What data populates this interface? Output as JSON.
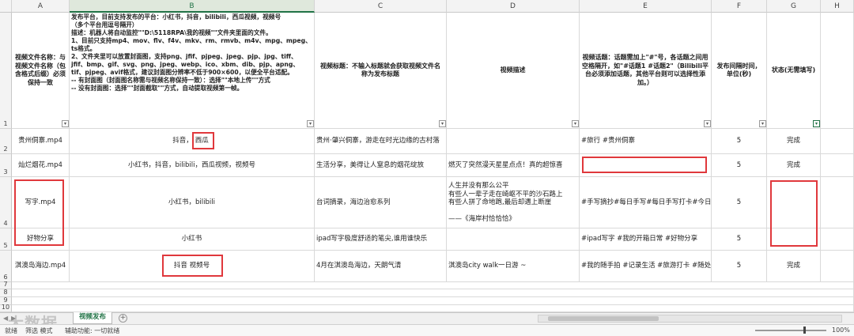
{
  "columns": [
    "A",
    "B",
    "C",
    "D",
    "E",
    "F",
    "G",
    "H"
  ],
  "rows": [
    "1",
    "2",
    "3",
    "4",
    "5",
    "6",
    "7",
    "8",
    "9",
    "10"
  ],
  "header": {
    "a": "视频文件名称：与视频文件名称（包含格式后缀）必须保持一致",
    "b_lines": [
      "发布平台，目前支持发布的平台：小红书，抖音，bilibili，西瓜视频，视频号",
      "（多个平台用逗号隔开）",
      "描述：机器人将自动监控\"\"D:\\5118RPA\\我的视频\"\"文件夹里面的文件。",
      "1、目前只支持mp4、mov、flv、f4v、mkv、rm、rmvb、m4v、mpg、mpeg、ts格式。",
      "2、文件夹里可以放置封面图，支持png、jfif、pjpeg、jpeg、pjp、jpg、tiff、jfif、bmp、gif、svg、png、jpeg、webp、ico、xbm、dib、pjp、apng、tif、pjpeg、avif格式，建议封面图分辨率不低于900×600，以便全平台适配。",
      "-- 有封面图（封面图名称需与视频名称保持一致）：选择\"\"本地上传\"\"方式",
      "-- 没有封面图：选择\"\"封面截取\"\"方式，自动提取视频第一帧。"
    ],
    "c": "视频标题：不输入标题就会获取视频文件名称为发布标题",
    "d": "视频描述",
    "e": "视频话题：话题需加上\"#\"号，各话题之间用空格隔开，如\"#话题1 #话题2\"（Bilibili平台必须添加话题，其他平台则可以选择性添加。）",
    "f": "发布间隔时间，单位(秒)",
    "g": "状态(无需填写)"
  },
  "data_rows": [
    {
      "a": "贵州侗寨.mp4",
      "b1": "抖音，",
      "b2": "西瓜",
      "c": "贵州·肇兴侗寨，游走在时光边缘的古村落",
      "d": "",
      "e": "#旅行 #贵州侗寨",
      "f": "5",
      "g": "完成"
    },
    {
      "a": "灿烂烟花.mp4",
      "b": "小红书，抖音，bilibili，西瓜视频，视频号",
      "c": "生活分享，美得让人窒息的烟花绽放",
      "d": "燃灭了突然漫天星星点点！真的超惊喜",
      "e": "",
      "f": "5",
      "g": "完成"
    },
    {
      "a": "写字.mp4",
      "b": "小红书，bilibili",
      "c": "台词摘录，海边治愈系列",
      "d_lines": [
        "人生并没有那么公平",
        "有些人一辈子走在崎岖不平的沙石路上",
        "有些人拼了命地跑,最后却遇上断崖",
        "",
        "——《海岸村恰恰恰》"
      ],
      "e": "#手写摘抄#每日手写#每日手写打卡#今日手",
      "f": "5",
      "g": ""
    },
    {
      "a": "好物分享",
      "b": "小红书",
      "c": "ipad写字极度舒适的笔尖,谁用谁快乐",
      "d": "",
      "e": "#ipad写字 #我的开箱日常 #好物分享",
      "f": "5",
      "g": ""
    },
    {
      "a": "淇澳岛海边.mp4",
      "b": "抖音 视频号",
      "c": "4月在淇澳岛海边，天朗气清",
      "d": "淇澳岛city walk一日游 ~",
      "e": "#我的随手拍 #记录生活 #旅游打卡 #随处者",
      "f": "5",
      "g": "完成"
    }
  ],
  "sheet_tab": "视频发布",
  "add_sheet": "+",
  "nav": [
    "◀",
    "▶"
  ],
  "watermark": "大数据",
  "status": {
    "ready": "就绪",
    "filter": "筛选 模式",
    "accessibility": "辅助功能: 一切就绪",
    "zoom": "100%"
  },
  "filter_icon": "▾",
  "filter_active_icon": "▾",
  "colors": {
    "accent": "#217346",
    "annotation": "#e0383c"
  }
}
